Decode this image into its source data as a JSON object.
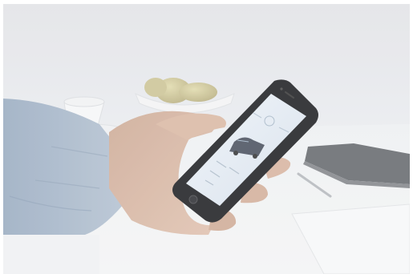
{
  "scene": {
    "subject": "hand-holding-smartphone",
    "colors": {
      "background": "#e6e7ea",
      "table": "#eeeff1",
      "sleeve": "#a9b7c9",
      "skin": "#d7b6a3",
      "phone_body": "#2a2b2e",
      "screen": "#dfe8f1",
      "notebook": "#6e7176"
    }
  }
}
